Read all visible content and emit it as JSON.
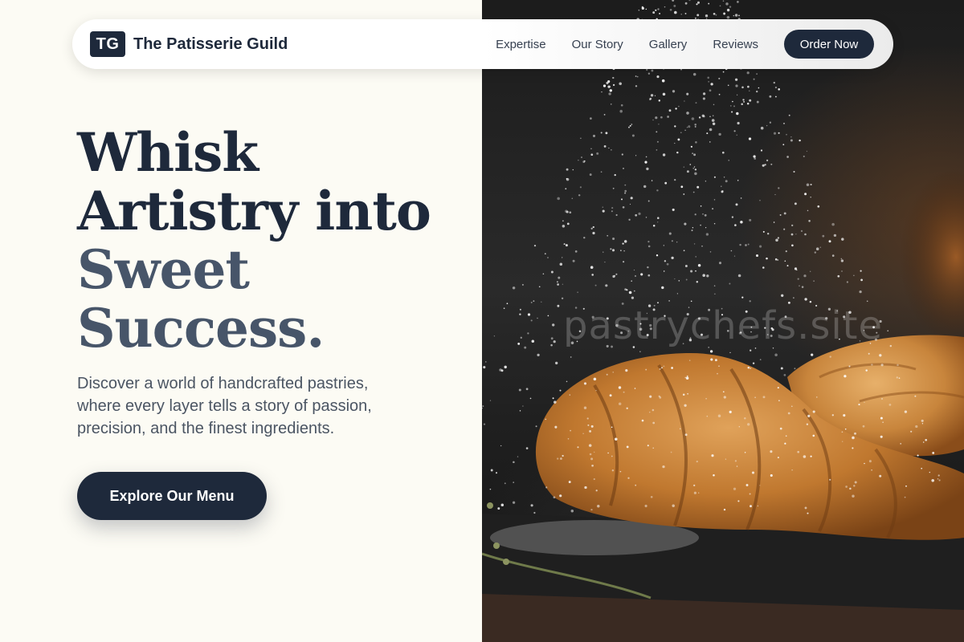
{
  "nav": {
    "logo_text": "TG",
    "brand_name": "The Patisserie Guild",
    "links": [
      "Expertise",
      "Our Story",
      "Gallery",
      "Reviews"
    ],
    "order_label": "Order Now"
  },
  "hero": {
    "headline_dark_1": "Whisk",
    "headline_dark_2": "Artistry into",
    "headline_light_1": "Sweet",
    "headline_light_2": "Success.",
    "subtitle": "Discover a world of handcrafted pastries, where every layer tells a story of passion, precision, and the finest ingredients.",
    "cta_label": "Explore Our Menu"
  },
  "image": {
    "watermark": "pastrychefs.site"
  },
  "colors": {
    "primary": "#1e293b",
    "secondary": "#475569",
    "background": "#fcfbf4"
  }
}
